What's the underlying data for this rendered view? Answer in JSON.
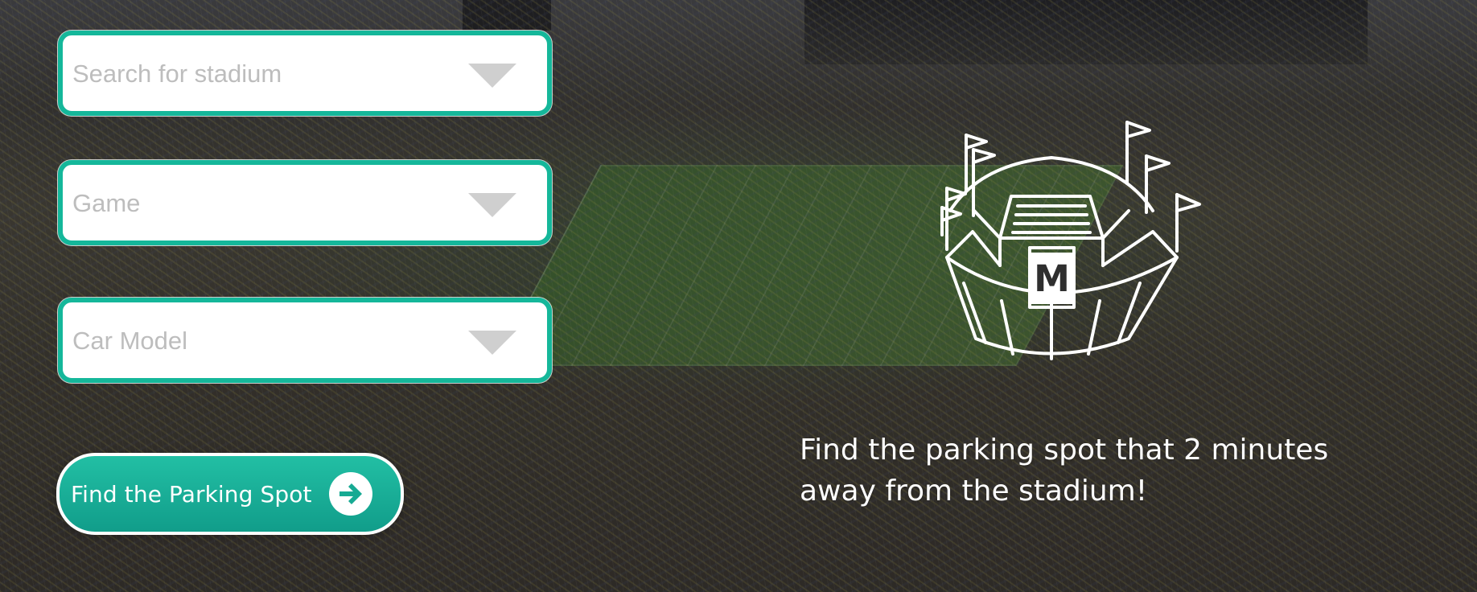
{
  "form": {
    "stadium_select": {
      "placeholder": "Search for stadium",
      "icon": "chevron-down-icon"
    },
    "game_select": {
      "placeholder": "Game",
      "icon": "chevron-down-icon"
    },
    "car_model_select": {
      "placeholder": "Car Model",
      "icon": "chevron-down-icon"
    },
    "submit_button": {
      "label": "Find the Parking Spot",
      "icon": "arrow-right-circle-icon"
    }
  },
  "hero": {
    "stadium_logo_letter": "M",
    "tagline": "Find the parking spot that 2 minutes away from the stadium!"
  },
  "colors": {
    "accent": "#15b79a",
    "button_gradient_top": "#22bfa4",
    "button_gradient_bottom": "#119d8a",
    "placeholder_text": "#bdbdbd",
    "white": "#ffffff"
  }
}
